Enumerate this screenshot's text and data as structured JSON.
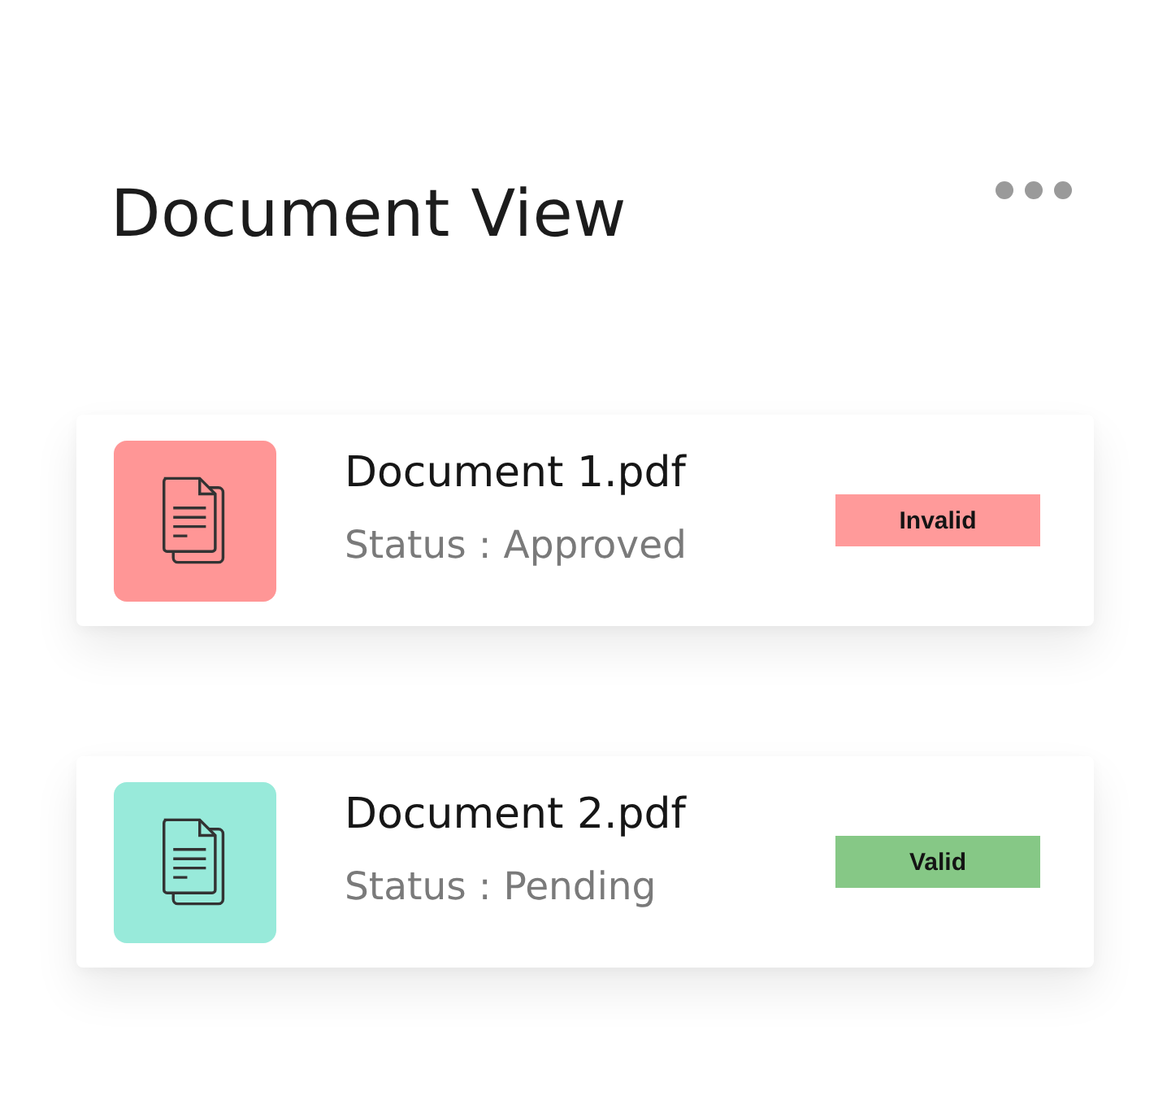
{
  "header": {
    "title": "Document View"
  },
  "documents": [
    {
      "name": "Document 1.pdf",
      "status": "Status : Approved",
      "color": "#ff9696",
      "badge": {
        "label": "Invalid",
        "color": "#ff9a9a"
      }
    },
    {
      "name": "Document 2.pdf",
      "status": "Status : Pending",
      "color": "#98eada",
      "badge": {
        "label": "Valid",
        "color": "#86c886"
      }
    }
  ]
}
